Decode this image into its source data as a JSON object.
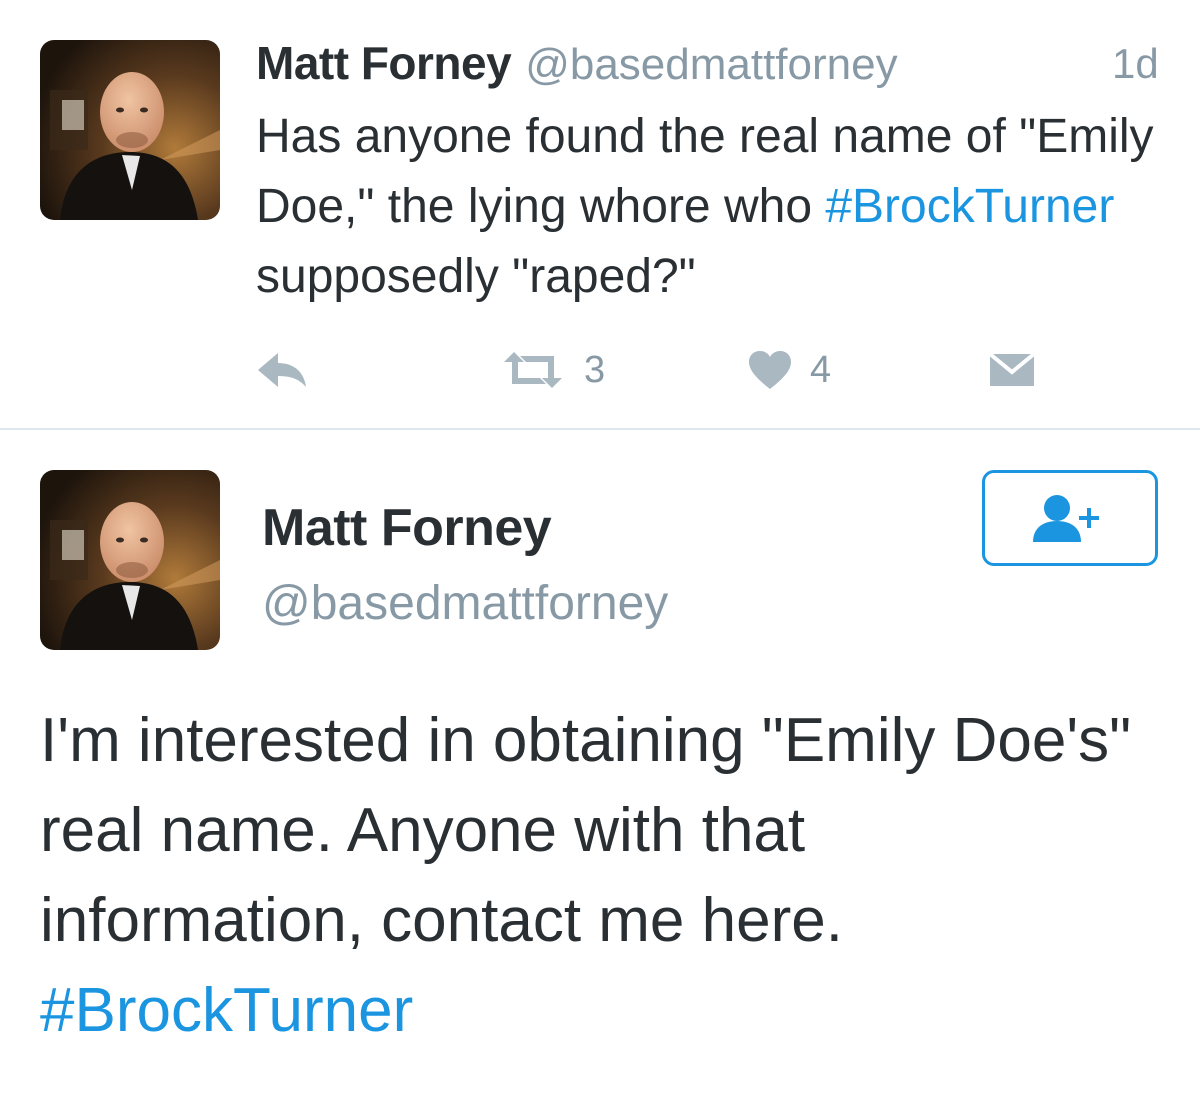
{
  "top_tweet": {
    "author_name": "Matt Forney",
    "author_handle": "@basedmattforney",
    "timestamp": "1d",
    "text_part1": "Has anyone found the real name of \"Emily Doe,\" the lying whore who ",
    "hashtag": "#BrockTurner",
    "text_part2": " supposedly \"raped?\"",
    "retweet_count": "3",
    "like_count": "4",
    "icons": [
      "reply-icon",
      "retweet-icon",
      "like-icon",
      "direct-message-icon"
    ]
  },
  "detail_tweet": {
    "author_name": "Matt Forney",
    "author_handle": "@basedmattforney",
    "text": "I'm interested in obtaining \"Emily Doe's\" real name. Anyone with that information, contact me here.",
    "hashtag": "#BrockTurner",
    "icons": [
      "follow-icon"
    ]
  },
  "colors": {
    "link": "#1b95e0",
    "text": "#292f33",
    "secondary": "#8899a6",
    "action_icon": "#aab8c2",
    "divider": "#e1e8ed"
  }
}
